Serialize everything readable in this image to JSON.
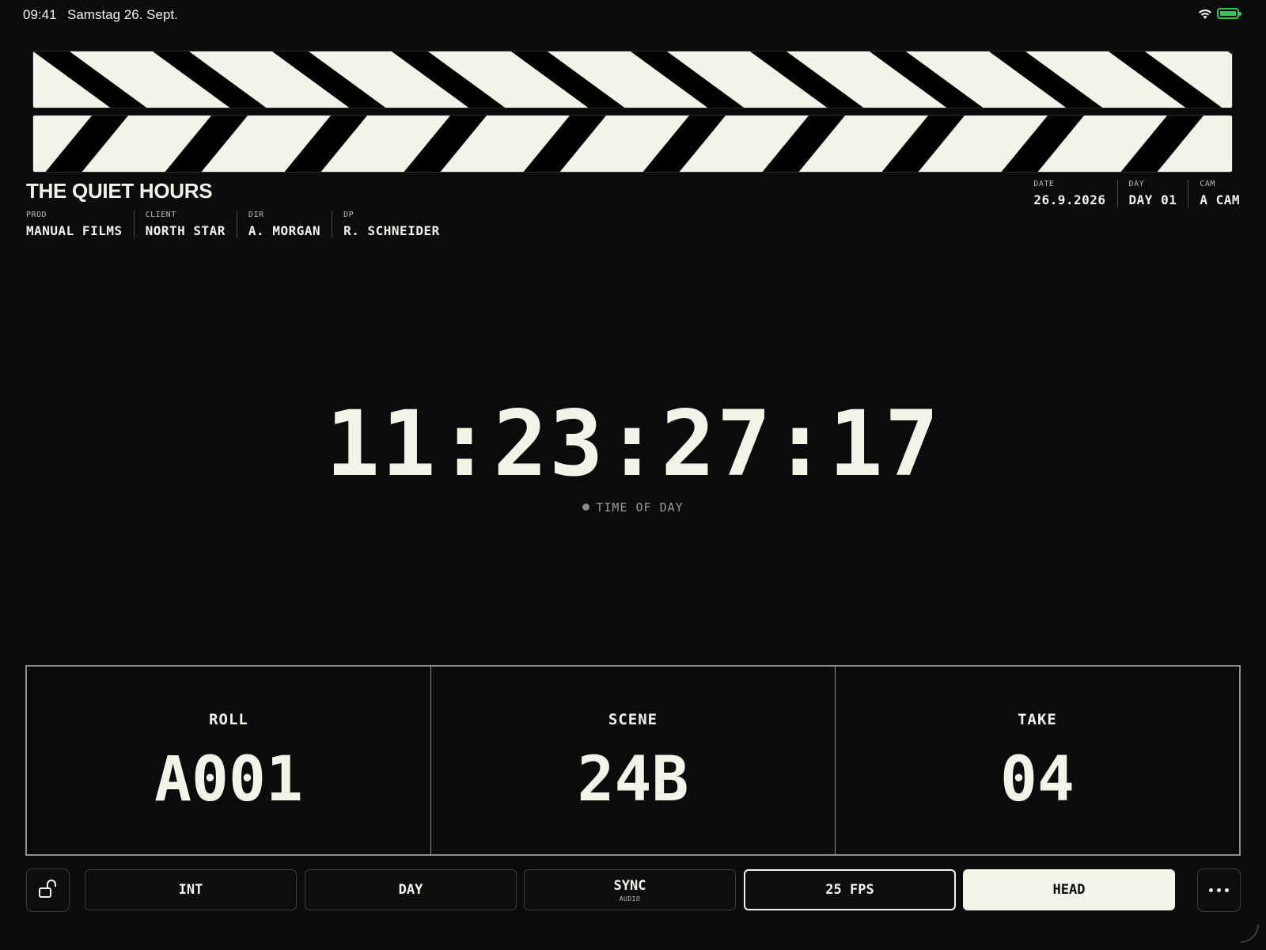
{
  "status_bar": {
    "time": "09:41",
    "date": "Samstag 26. Sept."
  },
  "production": {
    "title": "THE QUIET HOURS",
    "credits": [
      {
        "key": "PROD",
        "value": "MANUAL FILMS"
      },
      {
        "key": "CLIENT",
        "value": "NORTH STAR"
      },
      {
        "key": "DIR",
        "value": "A. MORGAN"
      },
      {
        "key": "DP",
        "value": "R. SCHNEIDER"
      }
    ],
    "shoot_info": [
      {
        "key": "DATE",
        "value": "26.9.2026"
      },
      {
        "key": "DAY",
        "value": "DAY 01"
      },
      {
        "key": "CAM",
        "value": "A CAM"
      }
    ]
  },
  "timecode": {
    "value": "11:23:27:17",
    "label": "TIME OF DAY"
  },
  "slate": [
    {
      "label": "ROLL",
      "value": "A001"
    },
    {
      "label": "SCENE",
      "value": "24B"
    },
    {
      "label": "TAKE",
      "value": "04"
    }
  ],
  "toolbar": {
    "lock_icon": "unlock-icon",
    "int_label": "INT",
    "day_label": "DAY",
    "sync_label": "SYNC",
    "sync_sub": "AUDIO",
    "fps_label": "25 FPS",
    "head_label": "HEAD",
    "more_icon": "more-icon"
  },
  "colors": {
    "background": "#0a0c0c",
    "foreground": "#f3f3ea",
    "stripe_light": "#f3f3ea",
    "stripe_dark": "#000000",
    "battery": "#3bc45c"
  }
}
